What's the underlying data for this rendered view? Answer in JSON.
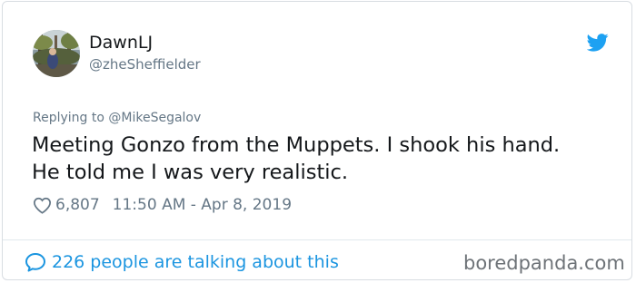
{
  "author": {
    "display_name": "DawnLJ",
    "handle": "@zheSheffielder"
  },
  "tweet": {
    "replying_to": "Replying to @MikeSegalov",
    "text_lines": [
      "Meeting Gonzo from the Muppets. I shook his hand.",
      "He told me I was very realistic."
    ],
    "like_count": "6,807",
    "timestamp": "11:50 AM - Apr 8, 2019"
  },
  "footer": {
    "talking_text": "226 people are talking about this",
    "watermark": "boredpanda.com"
  },
  "icons": {
    "brand": "twitter-bird-icon",
    "like": "heart-icon",
    "conversation": "speech-bubble-icon"
  },
  "colors": {
    "twitter_blue": "#1da1f2",
    "link_blue": "#1b95e0",
    "muted_text": "#657786",
    "primary_text": "#14171a",
    "border": "#d8dde2"
  }
}
